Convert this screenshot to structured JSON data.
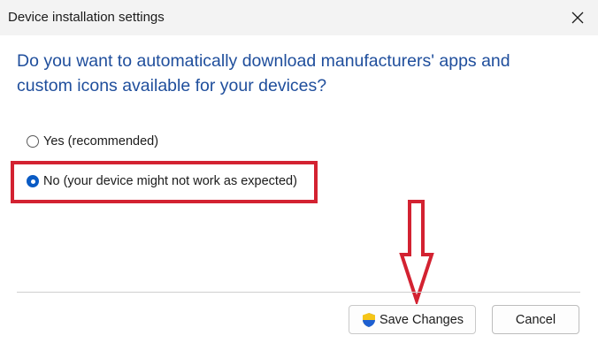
{
  "window": {
    "title": "Device installation settings"
  },
  "dialog": {
    "question": "Do you want to automatically download manufacturers' apps and custom icons available for your devices?",
    "options": [
      {
        "label": "Yes (recommended)",
        "selected": false
      },
      {
        "label": "No (your device might not work as expected)",
        "selected": true
      }
    ]
  },
  "buttons": {
    "save": "Save Changes",
    "cancel": "Cancel"
  },
  "icons": {
    "close": "close-icon",
    "save_shield": "uac-shield-icon"
  },
  "colors": {
    "question_text": "#1f4e9c",
    "radio_selected": "#0a5bc4",
    "annotation_red": "#d32231"
  }
}
